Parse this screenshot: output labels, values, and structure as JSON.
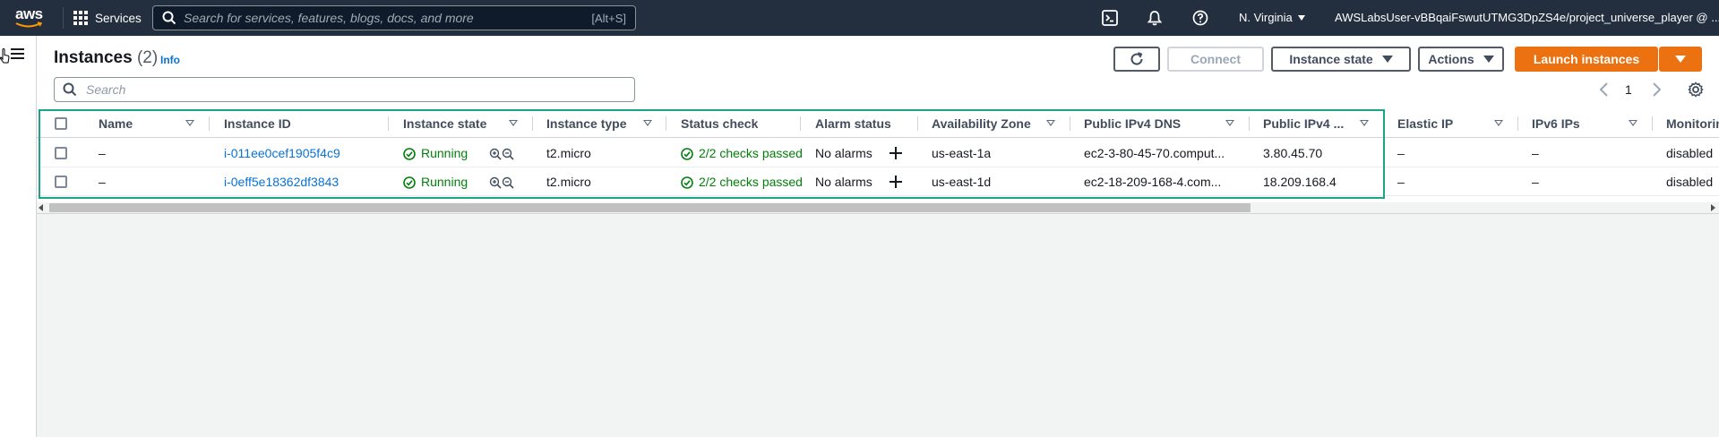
{
  "topnav": {
    "logo_text": "aws",
    "services_label": "Services",
    "search_placeholder": "Search for services, features, blogs, docs, and more",
    "search_shortcut": "[Alt+S]",
    "region": "N. Virginia",
    "account": "AWSLabsUser-vBBqaiFswutUTMG3DpZS4e/project_universe_player @ ..."
  },
  "header": {
    "title": "Instances",
    "count": "(2)",
    "info_label": "Info",
    "filter_placeholder": "Search",
    "connect_label": "Connect",
    "instance_state_label": "Instance state",
    "actions_label": "Actions",
    "launch_label": "Launch instances",
    "page_number": "1"
  },
  "table": {
    "columns": [
      "Name",
      "Instance ID",
      "Instance state",
      "Instance type",
      "Status check",
      "Alarm status",
      "Availability Zone",
      "Public IPv4 DNS",
      "Public IPv4 ...",
      "Elastic IP",
      "IPv6 IPs",
      "Monitoring"
    ],
    "rows": [
      {
        "name": "–",
        "instance_id": "i-011ee0cef1905f4c9",
        "state": "Running",
        "type": "t2.micro",
        "status_check": "2/2 checks passed",
        "alarm": "No alarms",
        "az": "us-east-1a",
        "dns": "ec2-3-80-45-70.comput...",
        "ipv4": "3.80.45.70",
        "elastic_ip": "–",
        "ipv6": "–",
        "monitoring": "disabled"
      },
      {
        "name": "–",
        "instance_id": "i-0eff5e18362df3843",
        "state": "Running",
        "type": "t2.micro",
        "status_check": "2/2 checks passed",
        "alarm": "No alarms",
        "az": "us-east-1d",
        "dns": "ec2-18-209-168-4.com...",
        "ipv4": "18.209.168.4",
        "elastic_ip": "–",
        "ipv6": "–",
        "monitoring": "disabled"
      }
    ]
  },
  "colors": {
    "nav_bg": "#232f3e",
    "primary": "#ec7211",
    "link": "#0972d3",
    "success": "#037f0c",
    "highlight": "#1aa58a"
  }
}
